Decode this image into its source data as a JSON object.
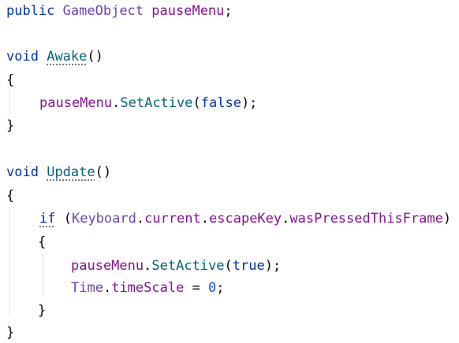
{
  "code": {
    "line1": {
      "kw": "public",
      "type": "GameObject",
      "field": "pauseMenu",
      "end": ";"
    },
    "line2": {
      "kw": "void",
      "method": "Awake",
      "parens": "()"
    },
    "line3": {
      "brace": "{"
    },
    "line4": {
      "obj": "pauseMenu",
      "dot": ".",
      "call": "SetActive",
      "open": "(",
      "arg": "false",
      "close": ");"
    },
    "line5": {
      "brace": "}"
    },
    "line6": {
      "kw": "void",
      "method": "Update",
      "parens": "()"
    },
    "line7": {
      "brace": "{"
    },
    "line8": {
      "kw": "if",
      "open": " (",
      "cls": "Keyboard",
      "d1": ".",
      "p1": "current",
      "d2": ".",
      "p2": "escapeKey",
      "d3": ".",
      "p3": "wasPressedThisFrame",
      "close": ")"
    },
    "line9": {
      "brace": "{"
    },
    "line10": {
      "obj": "pauseMenu",
      "dot": ".",
      "call": "SetActive",
      "open": "(",
      "arg": "true",
      "close": ");"
    },
    "line11": {
      "cls": "Time",
      "dot": ".",
      "prop": "timeScale",
      "eq": " = ",
      "num": "0",
      "end": ";"
    },
    "line12": {
      "brace": "}"
    },
    "line13": {
      "brace": "}"
    }
  }
}
